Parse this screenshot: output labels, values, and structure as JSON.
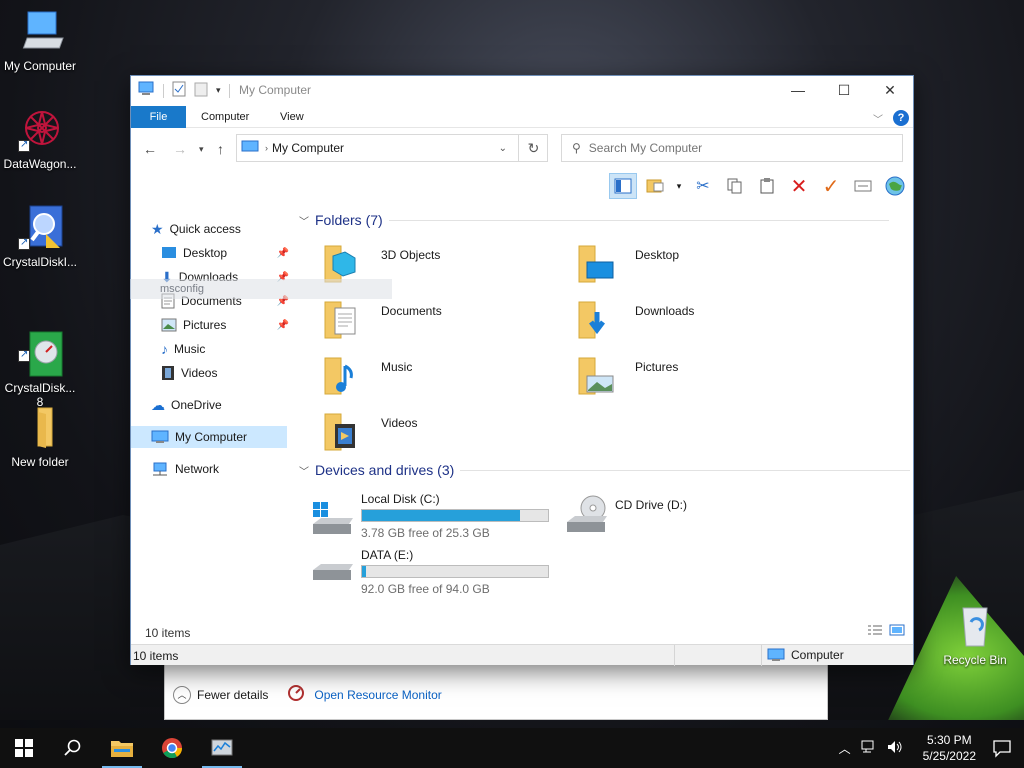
{
  "desktop": {
    "icons": [
      {
        "label": "My Computer",
        "icon": "monitor-icon"
      },
      {
        "label": "DataWagon...",
        "icon": "datawagon-icon"
      },
      {
        "label": "CrystalDiskI...",
        "icon": "crystaldiskinfo-icon"
      },
      {
        "label": "CrystalDisk...\n8",
        "icon": "crystaldiskmark-icon"
      },
      {
        "label": "New folder",
        "icon": "folder-icon"
      },
      {
        "label": "Recycle Bin",
        "icon": "recycle-bin-icon"
      }
    ],
    "ghost_text": "msconfig"
  },
  "explorer": {
    "title": "My Computer",
    "tabs": [
      "File",
      "Computer",
      "View"
    ],
    "address": "My Computer",
    "search_placeholder": "Search My Computer",
    "sidebar": {
      "quick_access": "Quick access",
      "items": [
        "Desktop",
        "Downloads",
        "Documents",
        "Pictures",
        "Music",
        "Videos"
      ],
      "onedrive": "OneDrive",
      "my_computer": "My Computer",
      "network": "Network"
    },
    "folders_header": "Folders (7)",
    "folders": [
      "3D Objects",
      "Desktop",
      "Documents",
      "Downloads",
      "Music",
      "Pictures",
      "Videos"
    ],
    "devices_header": "Devices and drives (3)",
    "drives": [
      {
        "name": "Local Disk (C:)",
        "free": "3.78 GB free of 25.3 GB",
        "used_fraction": 0.85
      },
      {
        "name": "CD Drive (D:)"
      },
      {
        "name": "DATA (E:)",
        "free": "92.0 GB free of 94.0 GB",
        "used_fraction": 0.02
      }
    ],
    "item_count": "10 items",
    "status_left": "10 items",
    "status_right": "Computer"
  },
  "taskmgr": {
    "fewer_details": "Fewer details",
    "resource_monitor": "Open Resource Monitor"
  },
  "taskbar": {
    "time": "5:30 PM",
    "date": "5/25/2022"
  },
  "colors": {
    "accent": "#1979ca",
    "drive_fill": "#26a0da",
    "header_blue": "#1e3287"
  }
}
